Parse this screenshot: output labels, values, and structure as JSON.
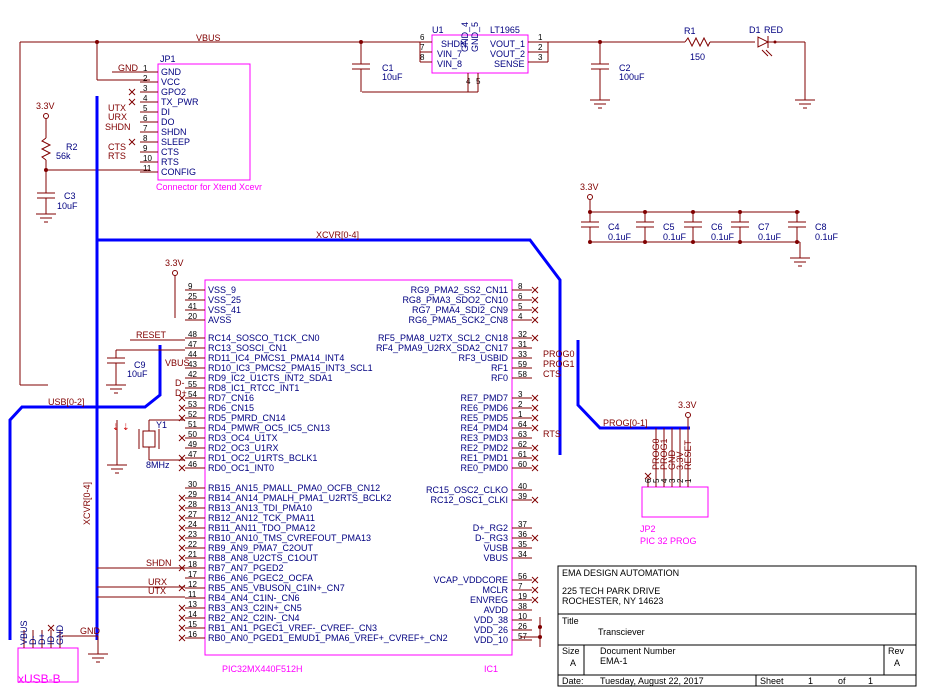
{
  "colors": {
    "wire": "#800000",
    "bus": "#0000ff",
    "body": "#ff00ff",
    "label": "#000080",
    "titleblock": "#000000"
  },
  "nets": {
    "vbus": "VBUS",
    "gnd": "GND",
    "v33": "3.3V",
    "xcvr_bus": "XCVR[0-4]",
    "usb_bus": "USB[0-2]",
    "prog_bus": "PROG[0-1]",
    "reset": "RESET",
    "shdn": "SHDN",
    "urx": "URX",
    "utx": "UTX",
    "cts": "CTS",
    "rts": "RTS",
    "prog0": "PROG0",
    "prog1": "PROG1",
    "d_minus": "D-",
    "d_plus": "D+",
    "vbus_short": "VBUS"
  },
  "components": {
    "u1": {
      "ref": "U1",
      "part": "LT1965",
      "pins_left": [
        "SHDN",
        "VIN_7",
        "VIN_8"
      ],
      "pins_right": [
        "VOUT_1",
        "VOUT_2",
        "SENSE"
      ],
      "gnd_pins": [
        "GND_4",
        "GND_5"
      ],
      "nums_left": [
        "6",
        "7",
        "8"
      ],
      "nums_right": [
        "1",
        "2",
        "3"
      ],
      "nums_gnd": [
        "4",
        "5"
      ]
    },
    "r1": {
      "ref": "R1",
      "value": "150"
    },
    "d1": {
      "ref": "D1",
      "value": "RED"
    },
    "c1": {
      "ref": "C1",
      "value": "10uF"
    },
    "c2": {
      "ref": "C2",
      "value": "100uF"
    },
    "r2": {
      "ref": "R2",
      "value": "56k"
    },
    "c3": {
      "ref": "C3",
      "value": "10uF"
    },
    "c9": {
      "ref": "C9",
      "value": "10uF"
    },
    "y1": {
      "ref": "Y1",
      "value": "8MHz"
    },
    "caps": [
      {
        "ref": "C4",
        "value": "0.1uF"
      },
      {
        "ref": "C5",
        "value": "0.1uF"
      },
      {
        "ref": "C6",
        "value": "0.1uF"
      },
      {
        "ref": "C7",
        "value": "0.1uF"
      },
      {
        "ref": "C8",
        "value": "0.1uF"
      }
    ],
    "jp1": {
      "ref": "JP1",
      "desc": "Connector for Xtend Xcevr",
      "pins": [
        "GND",
        "VCC",
        "GPO2",
        "TX_PWR",
        "DI",
        "DO",
        "SHDN",
        "SLEEP",
        "CTS",
        "RTS",
        "CONFIG"
      ],
      "nums": [
        "1",
        "2",
        "3",
        "4",
        "5",
        "6",
        "7",
        "8",
        "9",
        "10",
        "11"
      ]
    },
    "jp2": {
      "ref": "JP2",
      "desc": "PIC 32 PROG",
      "pins": [
        "PROG0",
        "PROG1",
        "GND",
        "3.3V",
        "RESET"
      ],
      "nums": [
        "6",
        "5",
        "4",
        "3",
        "2",
        "1"
      ]
    },
    "usb": {
      "ref": "xUSB-B",
      "pins": [
        "VBUS",
        "D-",
        "D+",
        "ID",
        "GND"
      ]
    },
    "ic1": {
      "ref": "IC1",
      "part": "PIC32MX440F512H",
      "left": [
        {
          "n": "9",
          "l": "VSS_9"
        },
        {
          "n": "25",
          "l": "VSS_25"
        },
        {
          "n": "41",
          "l": "VSS_41"
        },
        {
          "n": "20",
          "l": "AVSS"
        },
        {
          "n": "48",
          "l": "RC14_SOSCO_T1CK_CN0"
        },
        {
          "n": "47",
          "l": "RC13_SOSCI_CN1"
        },
        {
          "n": "44",
          "l": "RD11_IC4_PMCS1_PMA14_INT4"
        },
        {
          "n": "43",
          "l": "RD10_IC3_PMCS2_PMA15_INT3_SCL1"
        },
        {
          "n": "42",
          "l": "RD9_IC2_U1CTS_INT2_SDA1"
        },
        {
          "n": "55",
          "l": "RD8_IC1_RTCC_INT1"
        },
        {
          "n": "54",
          "l": "RD7_CN16"
        },
        {
          "n": "53",
          "l": "RD6_CN15"
        },
        {
          "n": "52",
          "l": "RD5_PMRD_CN14"
        },
        {
          "n": "51",
          "l": "RD4_PMWR_OC5_IC5_CN13"
        },
        {
          "n": "50",
          "l": "RD3_OC4_U1TX"
        },
        {
          "n": "49",
          "l": "RD2_OC3_U1RX"
        },
        {
          "n": "47",
          "l": "RD1_OC2_U1RTS_BCLK1"
        },
        {
          "n": "46",
          "l": "RD0_OC1_INT0"
        },
        {
          "n": "30",
          "l": "RB15_AN15_PMALL_PMA0_OCFB_CN12"
        },
        {
          "n": "29",
          "l": "RB14_AN14_PMALH_PMA1_U2RTS_BCLK2"
        },
        {
          "n": "28",
          "l": "RB13_AN13_TDI_PMA10"
        },
        {
          "n": "27",
          "l": "RB12_AN12_TCK_PMA11"
        },
        {
          "n": "24",
          "l": "RB11_AN11_TDO_PMA12"
        },
        {
          "n": "23",
          "l": "RB10_AN10_TMS_CVREFOUT_PMA13"
        },
        {
          "n": "22",
          "l": "RB9_AN9_PMA7_C2OUT"
        },
        {
          "n": "21",
          "l": "RB8_AN8_U2CTS_C1OUT"
        },
        {
          "n": "18",
          "l": "RB7_AN7_PGED2"
        },
        {
          "n": "17",
          "l": "RB6_AN6_PGEC2_OCFA"
        },
        {
          "n": "12",
          "l": "RB5_AN5_VBUSON_C1IN+_CN7"
        },
        {
          "n": "11",
          "l": "RB4_AN4_C1IN-_CN6"
        },
        {
          "n": "13",
          "l": "RB3_AN3_C2IN+_CN5"
        },
        {
          "n": "14",
          "l": "RB2_AN2_C2IN-_CN4"
        },
        {
          "n": "15",
          "l": "RB1_AN1_PGEC1_VREF-_CVREF-_CN3"
        },
        {
          "n": "16",
          "l": "RB0_AN0_PGED1_EMUD1_PMA6_VREF+_CVREF+_CN2"
        }
      ],
      "right": [
        {
          "n": "8",
          "l": "RG9_PMA2_SS2_CN11"
        },
        {
          "n": "6",
          "l": "RG8_PMA3_SDO2_CN10"
        },
        {
          "n": "5",
          "l": "RG7_PMA4_SDI2_CN9"
        },
        {
          "n": "4",
          "l": "RG6_PMA5_SCK2_CN8"
        },
        {
          "n": "32",
          "l": "RF5_PMA8_U2TX_SCL2_CN18"
        },
        {
          "n": "31",
          "l": "RF4_PMA9_U2RX_SDA2_CN17"
        },
        {
          "n": "33",
          "l": "RF3_USBID"
        },
        {
          "n": "59",
          "l": "RF1"
        },
        {
          "n": "58",
          "l": "RF0"
        },
        {
          "n": "3",
          "l": "RE7_PMD7"
        },
        {
          "n": "2",
          "l": "RE6_PMD6"
        },
        {
          "n": "1",
          "l": "RE5_PMD5"
        },
        {
          "n": "64",
          "l": "RE4_PMD4"
        },
        {
          "n": "63",
          "l": "RE3_PMD3"
        },
        {
          "n": "62",
          "l": "RE2_PMD2"
        },
        {
          "n": "61",
          "l": "RE1_PMD1"
        },
        {
          "n": "60",
          "l": "RE0_PMD0"
        },
        {
          "n": "40",
          "l": "RC15_OSC2_CLKO"
        },
        {
          "n": "39",
          "l": "RC12_OSC1_CLKI"
        },
        {
          "n": "37",
          "l": "D+_RG2"
        },
        {
          "n": "36",
          "l": "D-_RG3"
        },
        {
          "n": "35",
          "l": "VUSB"
        },
        {
          "n": "34",
          "l": "VBUS"
        },
        {
          "n": "56",
          "l": "VCAP_VDDCORE"
        },
        {
          "n": "7",
          "l": "MCLR"
        },
        {
          "n": "19",
          "l": "ENVREG"
        },
        {
          "n": "38",
          "l": "AVDD"
        },
        {
          "n": "10",
          "l": "VDD_38"
        },
        {
          "n": "26",
          "l": "VDD_26"
        },
        {
          "n": "57",
          "l": "VDD_10"
        }
      ]
    }
  },
  "titleblock": {
    "company": "EMA DESIGN AUTOMATION",
    "addr1": "225 TECH PARK DRIVE",
    "addr2": "ROCHESTER, NY 14623",
    "title_lbl": "Title",
    "title": "Transciever",
    "size_lbl": "Size",
    "size": "A",
    "docnum_lbl": "Document Number",
    "docnum": "EMA-1",
    "rev_lbl": "Rev",
    "rev": "A",
    "date_lbl": "Date:",
    "date": "Tuesday, August 22, 2017",
    "sheet_lbl": "Sheet",
    "sheet": "1",
    "of_lbl": "of",
    "sheets": "1"
  }
}
